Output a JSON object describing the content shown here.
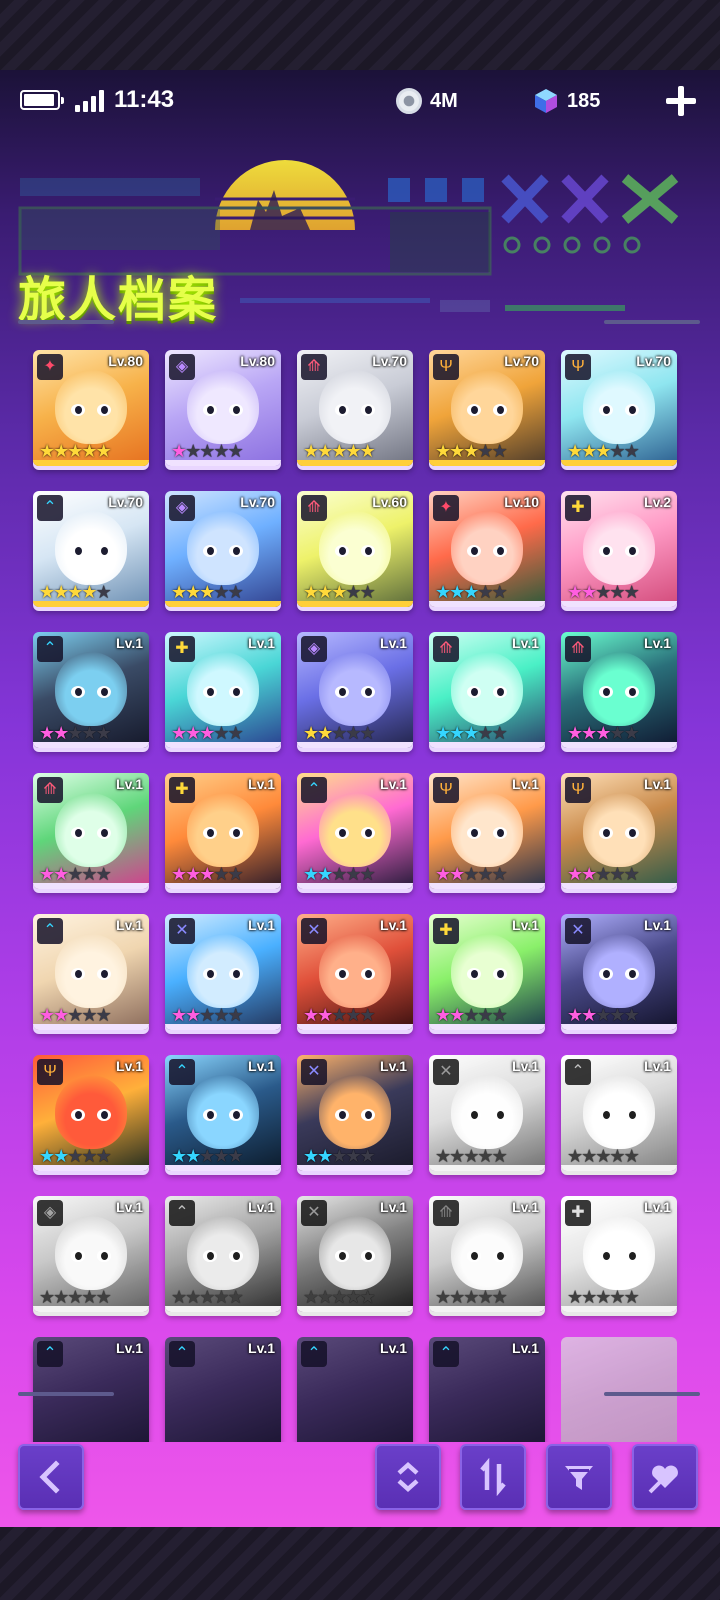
{
  "status_bar": {
    "time": "11:43",
    "coin_amount": "4M",
    "gem_amount": "185"
  },
  "header": {
    "title": "旅人档案"
  },
  "colors": {
    "gold_star": "#ffd93a",
    "cyan_star": "#35d6ff",
    "pink_star": "#ff5ee0",
    "title_green": "#e6ff4a"
  },
  "characters": [
    {
      "level": "Lv.80",
      "stars_on": 5,
      "star_color": "gold",
      "class_icon": "rogue-icon",
      "palette": "orange",
      "owned": true
    },
    {
      "level": "Lv.80",
      "stars_on": 1,
      "star_color": "pink",
      "class_icon": "support-icon",
      "palette": "lavender",
      "owned": true
    },
    {
      "level": "Lv.70",
      "stars_on": 5,
      "star_color": "gold",
      "class_icon": "archer-icon",
      "palette": "silver",
      "owned": true
    },
    {
      "level": "Lv.70",
      "stars_on": 3,
      "star_color": "gold",
      "class_icon": "guardian-icon",
      "palette": "amber",
      "owned": true
    },
    {
      "level": "Lv.70",
      "stars_on": 3,
      "star_color": "gold",
      "class_icon": "guardian-icon",
      "palette": "aqua",
      "owned": true
    },
    {
      "level": "Lv.70",
      "stars_on": 4,
      "star_color": "gold",
      "class_icon": "mage-icon",
      "palette": "ice",
      "owned": true
    },
    {
      "level": "Lv.70",
      "stars_on": 3,
      "star_color": "gold",
      "class_icon": "support-icon",
      "palette": "blue",
      "owned": true
    },
    {
      "level": "Lv.60",
      "stars_on": 3,
      "star_color": "gold",
      "class_icon": "archer-icon",
      "palette": "lime",
      "owned": true
    },
    {
      "level": "Lv.10",
      "stars_on": 3,
      "star_color": "cyan",
      "class_icon": "rogue-icon",
      "palette": "red",
      "owned": true
    },
    {
      "level": "Lv.2",
      "stars_on": 2,
      "star_color": "pink",
      "class_icon": "healer-icon",
      "palette": "pink",
      "owned": true
    },
    {
      "level": "Lv.1",
      "stars_on": 2,
      "star_color": "pink",
      "class_icon": "mage-icon",
      "palette": "dark",
      "owned": true
    },
    {
      "level": "Lv.1",
      "stars_on": 3,
      "star_color": "pink",
      "class_icon": "healer-icon",
      "palette": "teal",
      "owned": true
    },
    {
      "level": "Lv.1",
      "stars_on": 2,
      "star_color": "gold",
      "class_icon": "support-icon",
      "palette": "indigo",
      "owned": true
    },
    {
      "level": "Lv.1",
      "stars_on": 3,
      "star_color": "cyan",
      "class_icon": "archer-icon",
      "palette": "mint",
      "owned": true
    },
    {
      "level": "Lv.1",
      "stars_on": 3,
      "star_color": "pink",
      "class_icon": "archer-icon",
      "palette": "nightteal",
      "owned": true
    },
    {
      "level": "Lv.1",
      "stars_on": 2,
      "star_color": "pink",
      "class_icon": "archer-icon",
      "palette": "green",
      "owned": true
    },
    {
      "level": "Lv.1",
      "stars_on": 3,
      "star_color": "pink",
      "class_icon": "healer-icon",
      "palette": "robot",
      "owned": true
    },
    {
      "level": "Lv.1",
      "stars_on": 2,
      "star_color": "cyan",
      "class_icon": "mage-icon",
      "palette": "mask",
      "owned": true
    },
    {
      "level": "Lv.1",
      "stars_on": 2,
      "star_color": "pink",
      "class_icon": "guardian-icon",
      "palette": "ginger",
      "owned": true
    },
    {
      "level": "Lv.1",
      "stars_on": 2,
      "star_color": "pink",
      "class_icon": "guardian-icon",
      "palette": "tan",
      "owned": true
    },
    {
      "level": "Lv.1",
      "stars_on": 2,
      "star_color": "pink",
      "class_icon": "mage-icon",
      "palette": "blond",
      "owned": true
    },
    {
      "level": "Lv.1",
      "stars_on": 2,
      "star_color": "pink",
      "class_icon": "swords-icon",
      "palette": "sky",
      "owned": true
    },
    {
      "level": "Lv.1",
      "stars_on": 2,
      "star_color": "pink",
      "class_icon": "swords-icon",
      "palette": "crimson",
      "owned": true
    },
    {
      "level": "Lv.1",
      "stars_on": 2,
      "star_color": "pink",
      "class_icon": "healer-icon",
      "palette": "neon",
      "owned": true
    },
    {
      "level": "Lv.1",
      "stars_on": 2,
      "star_color": "pink",
      "class_icon": "swords-icon",
      "palette": "shadow",
      "owned": true
    },
    {
      "level": "Lv.1",
      "stars_on": 2,
      "star_color": "cyan",
      "class_icon": "guardian-icon",
      "palette": "witch",
      "owned": true
    },
    {
      "level": "Lv.1",
      "stars_on": 2,
      "star_color": "cyan",
      "class_icon": "mage-icon",
      "palette": "ninja",
      "owned": true
    },
    {
      "level": "Lv.1",
      "stars_on": 2,
      "star_color": "cyan",
      "class_icon": "swords-icon",
      "palette": "cap",
      "owned": true
    },
    {
      "level": "Lv.1",
      "stars_on": 0,
      "star_color": "gray",
      "class_icon": "swords-icon",
      "palette": "grey1",
      "owned": false
    },
    {
      "level": "Lv.1",
      "stars_on": 0,
      "star_color": "gray",
      "class_icon": "mage-icon",
      "palette": "grey2",
      "owned": false
    },
    {
      "level": "Lv.1",
      "stars_on": 0,
      "star_color": "gray",
      "class_icon": "support-icon",
      "palette": "grey3",
      "owned": false
    },
    {
      "level": "Lv.1",
      "stars_on": 0,
      "star_color": "gray",
      "class_icon": "mage-icon",
      "palette": "grey4",
      "owned": false
    },
    {
      "level": "Lv.1",
      "stars_on": 0,
      "star_color": "gray",
      "class_icon": "swords-icon",
      "palette": "grey5",
      "owned": false
    },
    {
      "level": "Lv.1",
      "stars_on": 0,
      "star_color": "gray",
      "class_icon": "archer-icon",
      "palette": "grey6",
      "owned": false
    },
    {
      "level": "Lv.1",
      "stars_on": 0,
      "star_color": "gray",
      "class_icon": "healer-icon",
      "palette": "grey7",
      "owned": false
    },
    {
      "level": "Lv.1",
      "stars_on": 0,
      "star_color": "gray",
      "class_icon": "mage-icon",
      "palette": "partial",
      "owned": true
    },
    {
      "level": "Lv.1",
      "stars_on": 0,
      "star_color": "gray",
      "class_icon": "mage-icon",
      "palette": "partial",
      "owned": true
    },
    {
      "level": "Lv.1",
      "stars_on": 0,
      "star_color": "gray",
      "class_icon": "mage-icon",
      "palette": "partial",
      "owned": true
    },
    {
      "level": "Lv.1",
      "stars_on": 0,
      "star_color": "gray",
      "class_icon": "mage-icon",
      "palette": "partial",
      "owned": true
    },
    {
      "level": "",
      "stars_on": 0,
      "star_color": "gray",
      "class_icon": "",
      "palette": "empty",
      "owned": false
    }
  ],
  "toolbar": {
    "back_icon": "back-arrow-icon",
    "expand_icon": "expand-collapse-icon",
    "sort_icon": "sort-icon",
    "filter_icon": "filter-icon",
    "favorite_icon": "heart-tag-icon"
  }
}
